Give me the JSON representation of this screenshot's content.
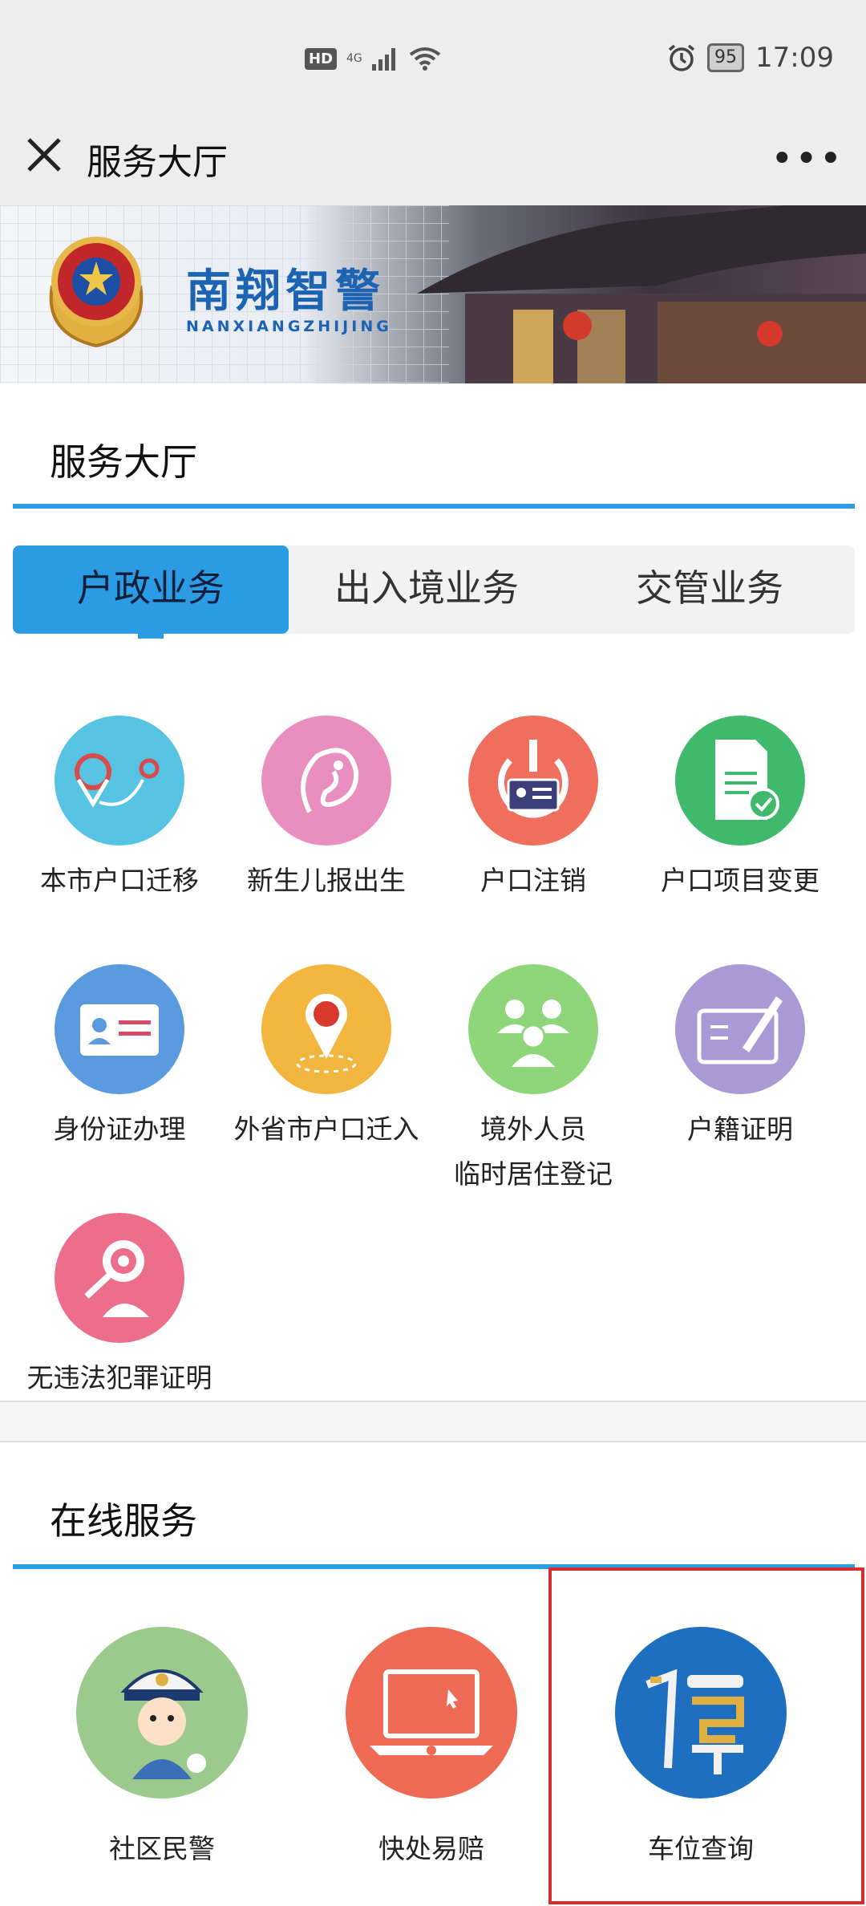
{
  "status_bar": {
    "time": "17:09",
    "battery": "95",
    "network": "4G"
  },
  "navbar": {
    "title": "服务大厅"
  },
  "banner": {
    "title": "南翔智警",
    "subtitle": "NANXIANGZHIJING"
  },
  "hall": {
    "title": "服务大厅",
    "tabs": [
      "户政业务",
      "出入境业务",
      "交管业务"
    ],
    "active_tab": "户政业务",
    "services": [
      {
        "label": "本市户口迁移",
        "icon": "route-pin-icon",
        "color": "#56c3e3"
      },
      {
        "label": "新生儿报出生",
        "icon": "fetus-icon",
        "color": "#e98fc0"
      },
      {
        "label": "户口注销",
        "icon": "power-id-card-icon",
        "color": "#ef6e5e"
      },
      {
        "label": "户口项目变更",
        "icon": "document-check-icon",
        "color": "#3fba6d"
      },
      {
        "label": "身份证办理",
        "icon": "id-card-icon",
        "color": "#5a9be0"
      },
      {
        "label": "外省市户口迁入",
        "icon": "location-pin-icon",
        "color": "#f2b63e"
      },
      {
        "label": "境外人员",
        "label2": "临时居住登记",
        "icon": "people-group-icon",
        "color": "#8fd67b"
      },
      {
        "label": "户籍证明",
        "icon": "form-pen-icon",
        "color": "#a99ad6"
      },
      {
        "label": "无违法犯罪证明",
        "icon": "magnifier-person-icon",
        "color": "#ec6e8a"
      }
    ]
  },
  "online": {
    "title": "在线服务",
    "services": [
      {
        "label": "社区民警",
        "icon": "police-officer-icon",
        "color": "#9cc98c"
      },
      {
        "label": "快处易赔",
        "icon": "laptop-icon",
        "color": "#ee6a55"
      },
      {
        "label": "车位查询",
        "icon": "parking-icon",
        "color": "#1f6fc0"
      }
    ]
  }
}
